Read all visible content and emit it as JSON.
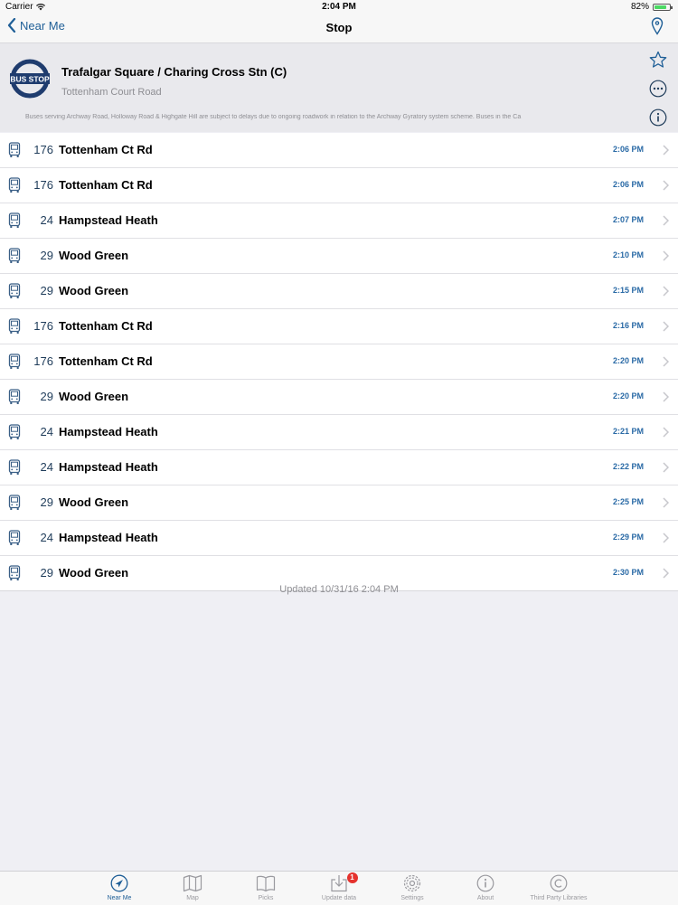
{
  "status_bar": {
    "carrier": "Carrier",
    "time": "2:04 PM",
    "battery": "82%",
    "battery_level": 0.82
  },
  "nav": {
    "back_label": "Near Me",
    "title": "Stop"
  },
  "stop": {
    "logo_text": "BUS STOP",
    "name": "Trafalgar Square / Charing Cross Stn (C)",
    "towards": "Tottenham Court Road",
    "notice": "Buses serving Archway Road, Holloway Road & Highgate Hill are subject to delays due to ongoing roadwork in relation to the Archway Gyratory system scheme.      Buses in the Ca"
  },
  "arrivals": [
    {
      "route": "176",
      "destination": "Tottenham Ct Rd",
      "time": "2:06 PM"
    },
    {
      "route": "176",
      "destination": "Tottenham Ct Rd",
      "time": "2:06 PM"
    },
    {
      "route": "24",
      "destination": "Hampstead Heath",
      "time": "2:07 PM"
    },
    {
      "route": "29",
      "destination": "Wood Green",
      "time": "2:10 PM"
    },
    {
      "route": "29",
      "destination": "Wood Green",
      "time": "2:15 PM"
    },
    {
      "route": "176",
      "destination": "Tottenham Ct Rd",
      "time": "2:16 PM"
    },
    {
      "route": "176",
      "destination": "Tottenham Ct Rd",
      "time": "2:20 PM"
    },
    {
      "route": "29",
      "destination": "Wood Green",
      "time": "2:20 PM"
    },
    {
      "route": "24",
      "destination": "Hampstead Heath",
      "time": "2:21 PM"
    },
    {
      "route": "24",
      "destination": "Hampstead Heath",
      "time": "2:22 PM"
    },
    {
      "route": "29",
      "destination": "Wood Green",
      "time": "2:25 PM"
    },
    {
      "route": "24",
      "destination": "Hampstead Heath",
      "time": "2:29 PM"
    },
    {
      "route": "29",
      "destination": "Wood Green",
      "time": "2:30 PM"
    }
  ],
  "updated": "Updated 10/31/16 2:04 PM",
  "tabs": [
    {
      "label": "Near Me",
      "icon": "location-arrow-icon",
      "active": true
    },
    {
      "label": "Map",
      "icon": "map-icon"
    },
    {
      "label": "Picks",
      "icon": "book-icon"
    },
    {
      "label": "Update data",
      "icon": "download-icon",
      "badge": "1"
    },
    {
      "label": "Settings",
      "icon": "gear-icon"
    },
    {
      "label": "About",
      "icon": "info-icon"
    },
    {
      "label": "Third Party Libraries",
      "icon": "copyright-icon"
    }
  ],
  "colors": {
    "accent": "#1f5f97",
    "time": "#2a6aa6",
    "battery": "#4cd964",
    "badge": "#e5322d"
  }
}
